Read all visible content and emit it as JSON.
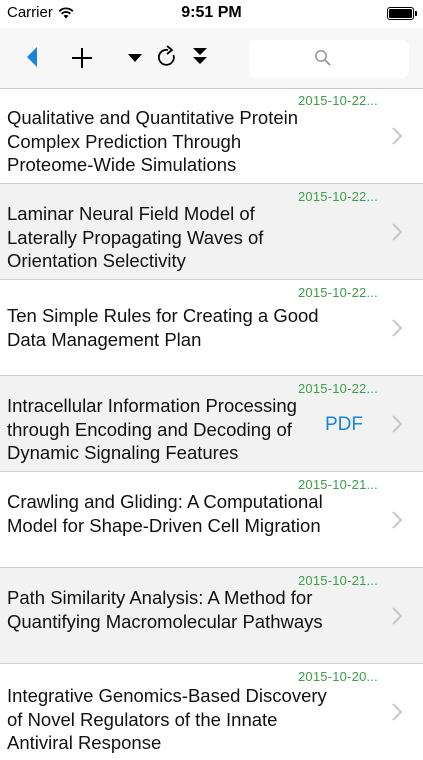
{
  "status_bar": {
    "carrier": "Carrier",
    "time": "9:51 PM"
  },
  "toolbar": {
    "back_icon": "back-triangle-icon",
    "add_icon": "plus-icon",
    "sort_icon": "dropdown-triangle-icon",
    "refresh_icon": "refresh-icon",
    "collapse_icon": "double-chevron-down-icon",
    "search_placeholder": "",
    "accent_color": "#1a82e0"
  },
  "articles": [
    {
      "date": "2015-10-22...",
      "title": "Qualitative and Quantitative Protein Complex Prediction Through Proteome-Wide Simulations",
      "pdf": ""
    },
    {
      "date": "2015-10-22...",
      "title": "Laminar Neural Field Model of Laterally Propagating Waves of Orientation Selectivity",
      "pdf": ""
    },
    {
      "date": "2015-10-22...",
      "title": "Ten Simple Rules for Creating a Good Data Management Plan",
      "pdf": ""
    },
    {
      "date": "2015-10-22...",
      "title": "Intracellular Information Processing through Encoding and Decoding of Dynamic Signaling Features",
      "pdf": "PDF"
    },
    {
      "date": "2015-10-21...",
      "title": "Crawling and Gliding: A Computational Model for Shape-Driven Cell Migration",
      "pdf": ""
    },
    {
      "date": "2015-10-21...",
      "title": "Path Similarity Analysis: A Method for Quantifying Macromolecular Pathways",
      "pdf": ""
    },
    {
      "date": "2015-10-20...",
      "title": "Integrative Genomics-Based Discovery of Novel Regulators of the Innate Antiviral Response",
      "pdf": ""
    }
  ],
  "colors": {
    "date_green": "#3aa14a",
    "pdf_blue": "#1a82e0",
    "alt_row": "#f2f2f2"
  }
}
